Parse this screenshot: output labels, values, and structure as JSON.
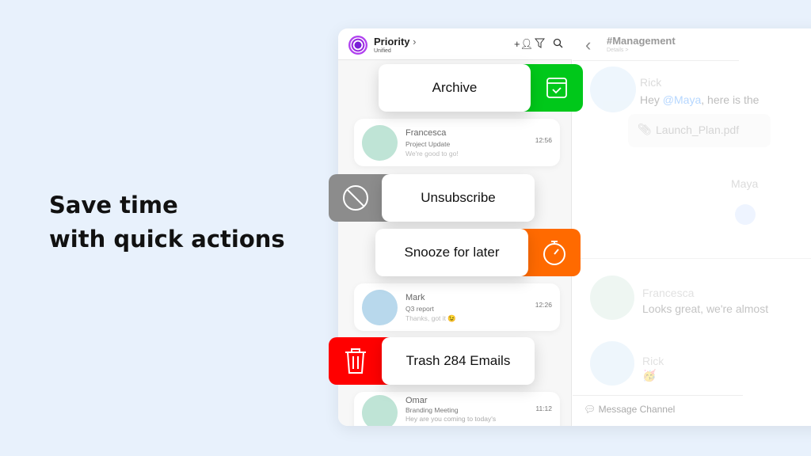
{
  "headline": {
    "line1": "Save time",
    "line2": "with quick actions"
  },
  "app": {
    "title": "Priority",
    "subtitle": "Unified",
    "channel": {
      "name": "#Management",
      "details": "Details >"
    },
    "mail": [
      {
        "name": "Francesca",
        "subject": "Project Update",
        "preview": "We're good to go!",
        "time": "12:56"
      },
      {
        "name": "Mark",
        "subject": "Q3 report",
        "preview": "Thanks, got it 😉",
        "time": "12:26"
      },
      {
        "name": "Omar",
        "subject": "Branding Meeting",
        "preview": "Hey are you coming to today's",
        "time": "11:12"
      }
    ],
    "messages": [
      {
        "name": "Rick",
        "text_pre": "Hey ",
        "mention": "@Maya",
        "text_post": ", here is the",
        "attachment": "Launch_Plan.pdf"
      },
      {
        "name": "Maya"
      },
      {
        "name": "Francesca",
        "text": "Looks great, we're almost"
      },
      {
        "name": "Rick",
        "text": "🥳"
      }
    ],
    "composer_placeholder": "Message Channel"
  },
  "actions": {
    "archive": "Archive",
    "unsubscribe": "Unsubscribe",
    "snooze": "Snooze for later",
    "trash": "Trash 284 Emails"
  },
  "colors": {
    "archive": "#00c81a",
    "unsubscribe": "#8c8c8c",
    "snooze": "#ff6a00",
    "trash": "#ff0000"
  }
}
